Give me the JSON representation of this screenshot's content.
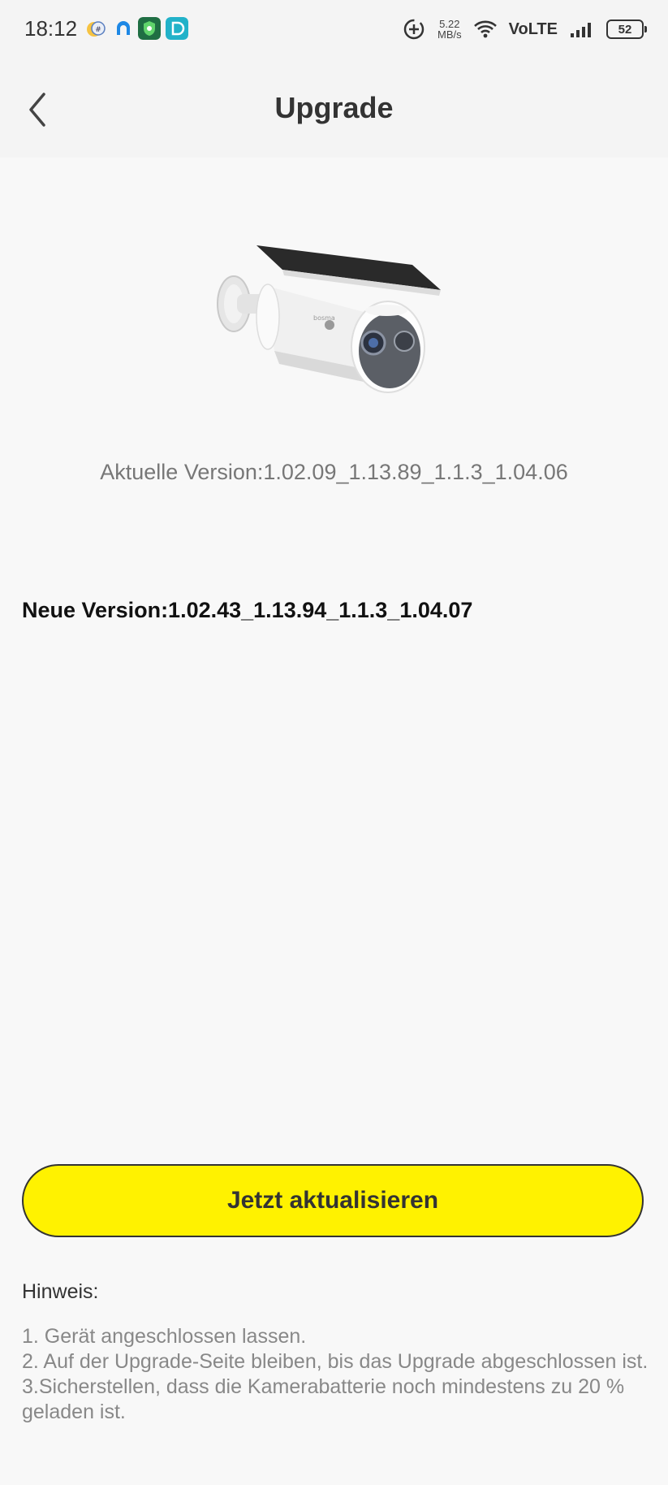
{
  "status_bar": {
    "time": "18:12",
    "net_speed_value": "5.22",
    "net_speed_unit": "MB/s",
    "network_label": "VoLTE",
    "battery_level": "52",
    "app_icons": [
      "weather-icon",
      "home-icon",
      "shield-icon",
      "app-icon"
    ]
  },
  "header": {
    "title": "Upgrade"
  },
  "device": {
    "current_version": "Aktuelle Version:1.02.09_1.13.89_1.1.3_1.04.06",
    "new_version": "Neue Version:1.02.43_1.13.94_1.1.3_1.04.07"
  },
  "actions": {
    "update_label": "Jetzt aktualisieren"
  },
  "hint": {
    "title": "Hinweis:",
    "items": [
      "1. Gerät angeschlossen lassen.",
      "2. Auf der Upgrade-Seite bleiben, bis das Upgrade abgeschlossen ist.",
      "3.Sicherstellen, dass die Kamerabatterie noch mindestens zu 20 % geladen ist."
    ]
  },
  "colors": {
    "button_bg": "#fff200",
    "background": "#f8f8f8"
  }
}
